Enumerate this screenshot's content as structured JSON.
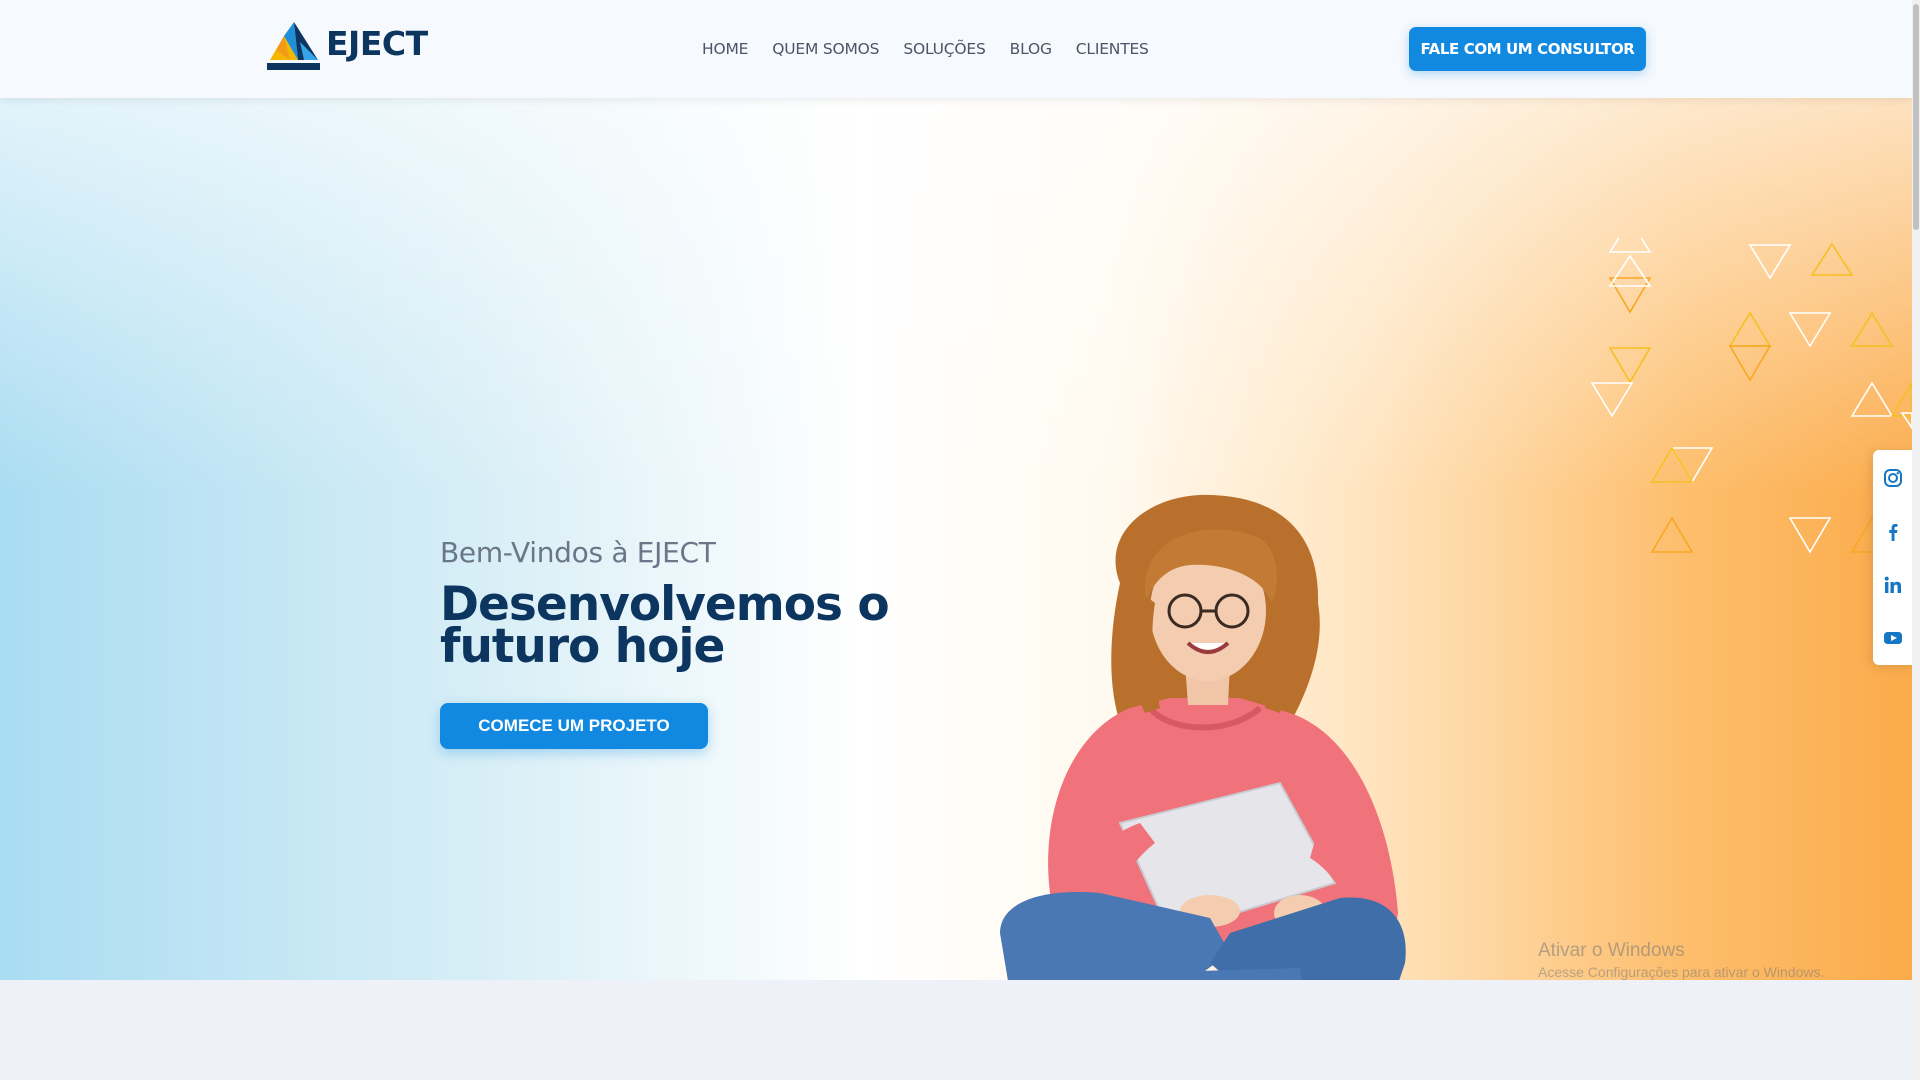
{
  "brand": {
    "name": "EJECT"
  },
  "nav": {
    "items": [
      {
        "label": "HOME"
      },
      {
        "label": "QUEM SOMOS"
      },
      {
        "label": "SOLUÇÕES"
      },
      {
        "label": "BLOG"
      },
      {
        "label": "CLIENTES"
      }
    ]
  },
  "header": {
    "cta_label": "FALE COM UM CONSULTOR"
  },
  "hero": {
    "welcome": "Bem-Vindos à EJECT",
    "headline_line1": "Desenvolvemos o",
    "headline_line2": "futuro hoje",
    "cta_label": "COMECE UM PROJETO"
  },
  "social": {
    "items": [
      {
        "icon": "instagram-icon"
      },
      {
        "icon": "facebook-icon"
      },
      {
        "icon": "linkedin-icon"
      },
      {
        "icon": "youtube-icon"
      }
    ]
  },
  "watermark": {
    "title": "Ativar o Windows",
    "subtitle": "Acesse Configurações para ativar o Windows."
  },
  "colors": {
    "primary": "#1289e0",
    "navy": "#0c3560",
    "orange": "#fbab4a",
    "yellow": "#f5b800"
  }
}
